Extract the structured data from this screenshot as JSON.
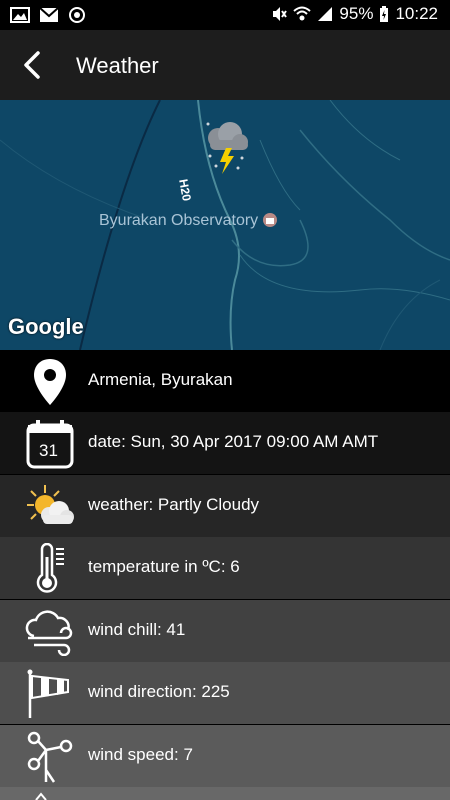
{
  "status_bar": {
    "battery": "95%",
    "time": "10:22"
  },
  "toolbar": {
    "title": "Weather"
  },
  "map": {
    "place_label": "Byurakan Observatory",
    "road_label": "H20",
    "attribution": "Google"
  },
  "rows": [
    {
      "icon": "location-pin-icon",
      "text": "Armenia, Byurakan",
      "bg": "#000000"
    },
    {
      "icon": "calendar-icon",
      "text": "date: Sun, 30 Apr 2017 09:00 AM AMT",
      "calendar_day": "31",
      "bg": "#141414"
    },
    {
      "icon": "partly-cloudy-icon",
      "text": "weather: Partly Cloudy",
      "bg": "#262626"
    },
    {
      "icon": "thermometer-icon",
      "text": "temperature in ºC: 6",
      "bg": "#343434"
    },
    {
      "icon": "wind-chill-icon",
      "text": "wind chill: 41",
      "bg": "#414141"
    },
    {
      "icon": "windsock-icon",
      "text": "wind direction: 225",
      "bg": "#4e4e4e"
    },
    {
      "icon": "wind-speed-icon",
      "text": "wind speed: 7",
      "bg": "#5b5b5b"
    },
    {
      "icon": "next-row-icon",
      "text": "",
      "bg": "#686868"
    }
  ]
}
